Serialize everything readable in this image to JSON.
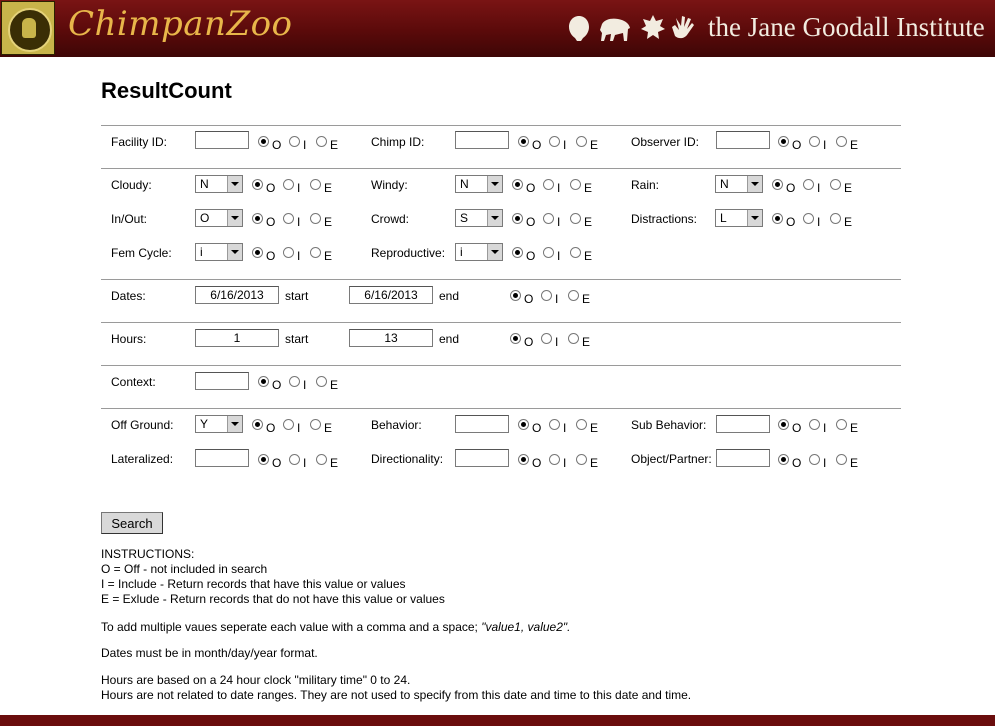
{
  "header": {
    "app_title": "ChimpanZoo",
    "institute": "the Jane Goodall Institute",
    "logo_icon": "chimpanzoo-badge-logo",
    "icons": [
      "chimp-head-icon",
      "chimp-walking-icon",
      "leaf-icon",
      "hand-icon"
    ]
  },
  "page": {
    "title": "ResultCount"
  },
  "radio_labels": [
    "O",
    "I",
    "E"
  ],
  "fields": {
    "facility_id": {
      "label": "Facility ID:",
      "value": ""
    },
    "chimp_id": {
      "label": "Chimp ID:",
      "value": ""
    },
    "observer_id": {
      "label": "Observer ID:",
      "value": ""
    },
    "cloudy": {
      "label": "Cloudy:",
      "value": "N"
    },
    "windy": {
      "label": "Windy:",
      "value": "N"
    },
    "rain": {
      "label": "Rain:",
      "value": "N"
    },
    "in_out": {
      "label": "In/Out:",
      "value": "O"
    },
    "crowd": {
      "label": "Crowd:",
      "value": "S"
    },
    "distractions": {
      "label": "Distractions:",
      "value": "L"
    },
    "fem_cycle": {
      "label": "Fem Cycle:",
      "value": "i"
    },
    "reproductive": {
      "label": "Reproductive:",
      "value": "i"
    },
    "dates": {
      "label": "Dates:",
      "start": "6/16/2013",
      "start_label": "start",
      "end": "6/16/2013",
      "end_label": "end"
    },
    "hours": {
      "label": "Hours:",
      "start": "1",
      "start_label": "start",
      "end": "13",
      "end_label": "end"
    },
    "context": {
      "label": "Context:",
      "value": ""
    },
    "off_ground": {
      "label": "Off Ground:",
      "value": "Y"
    },
    "behavior": {
      "label": "Behavior:",
      "value": ""
    },
    "sub_behavior": {
      "label": "Sub Behavior:",
      "value": ""
    },
    "lateralized": {
      "label": "Lateralized:",
      "value": ""
    },
    "directionality": {
      "label": "Directionality:",
      "value": ""
    },
    "object_partner": {
      "label": "Object/Partner:",
      "value": ""
    }
  },
  "search_button": "Search",
  "instructions": {
    "heading": "INSTRUCTIONS:",
    "o": "O = Off - not included in search",
    "i": "I = Include - Return records that have this value or values",
    "e": "E = Exlude - Return records that do not have this value or values",
    "multi_prefix": "To add multiple vaues seperate each value with a comma and a space; ",
    "multi_example": "\"value1, value2\".",
    "dates": "Dates must be in month/day/year format.",
    "hours1": "Hours are based on a 24 hour clock \"military time\" 0 to 24.",
    "hours2": "Hours are not related to date ranges. They are not used to specify from this date and time to this date and time."
  },
  "colors": {
    "header_bg": "#6a0d0d",
    "title_gold": "#e8b64a",
    "institute_text": "#f2ece0"
  }
}
